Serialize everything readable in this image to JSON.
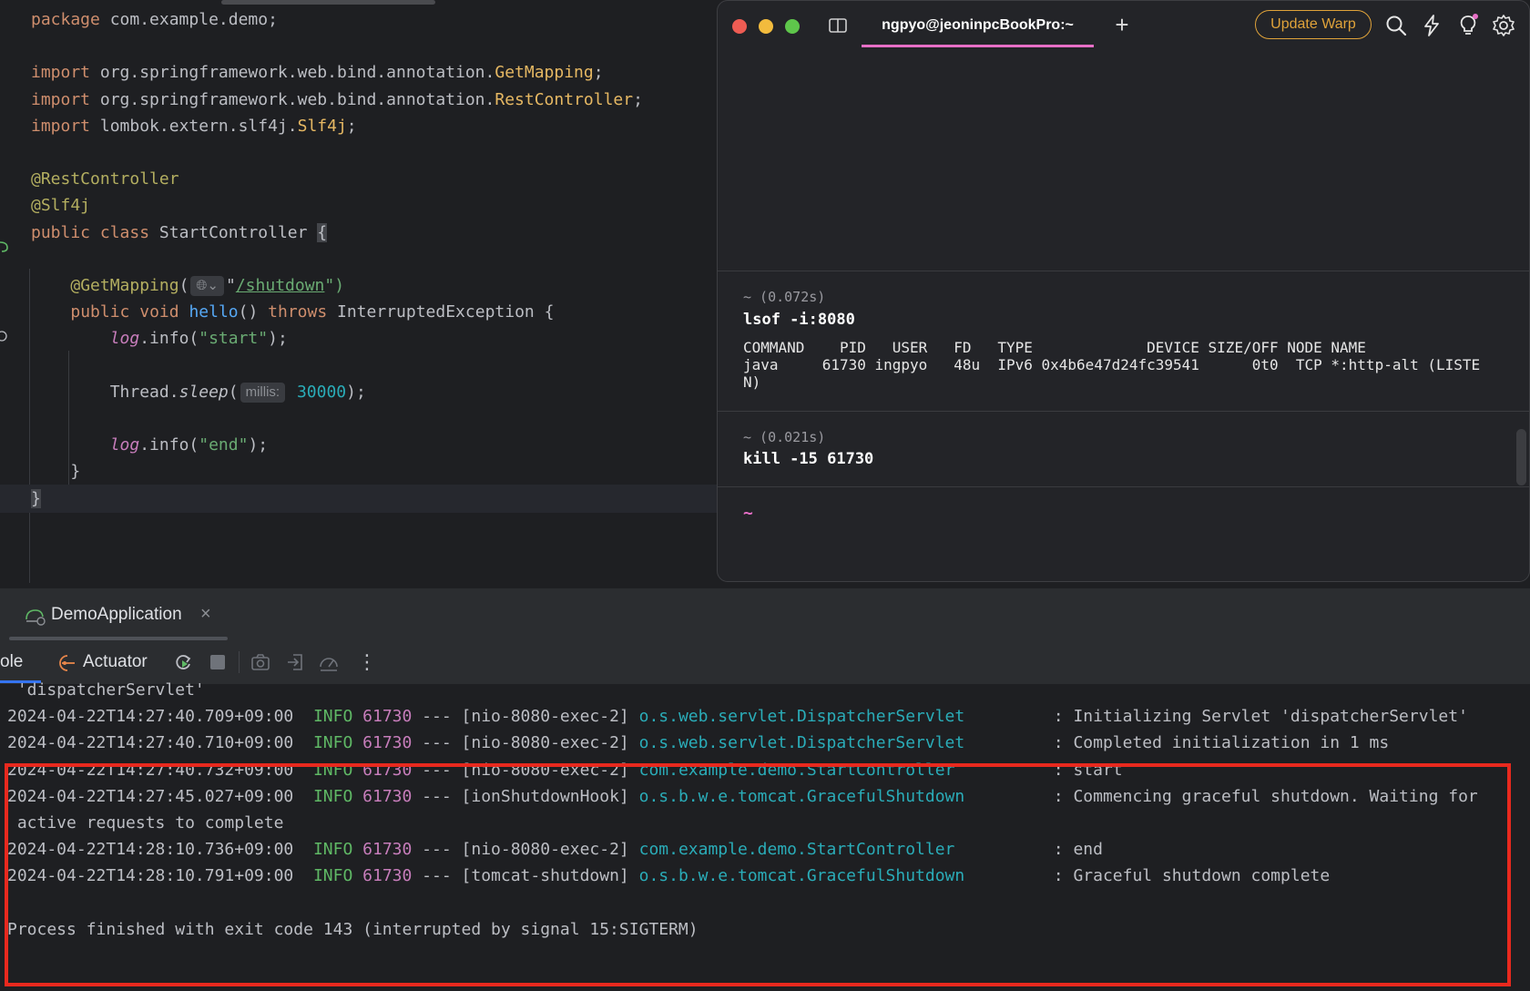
{
  "editor": {
    "lines": [
      {
        "tokens": [
          {
            "t": "package",
            "c": "kw"
          },
          {
            "t": " com.example.demo;"
          }
        ]
      },
      {
        "tokens": []
      },
      {
        "tokens": [
          {
            "t": "import",
            "c": "kw"
          },
          {
            "t": " org.springframework.web.bind.annotation."
          },
          {
            "t": "GetMapping",
            "c": "cls"
          },
          {
            "t": ";"
          }
        ]
      },
      {
        "tokens": [
          {
            "t": "import",
            "c": "kw"
          },
          {
            "t": " org.springframework.web.bind.annotation."
          },
          {
            "t": "RestController",
            "c": "cls"
          },
          {
            "t": ";"
          }
        ]
      },
      {
        "tokens": [
          {
            "t": "import",
            "c": "kw"
          },
          {
            "t": " lombok.extern.slf4j."
          },
          {
            "t": "Slf4j",
            "c": "cls"
          },
          {
            "t": ";"
          }
        ]
      },
      {
        "tokens": []
      },
      {
        "tokens": [
          {
            "t": "@RestController",
            "c": "ann"
          }
        ]
      },
      {
        "tokens": [
          {
            "t": "@Slf4j",
            "c": "ann"
          }
        ]
      },
      {
        "tokens": [
          {
            "t": "public",
            "c": "kw"
          },
          {
            "t": " "
          },
          {
            "t": "class",
            "c": "kw"
          },
          {
            "t": " StartController "
          },
          {
            "t": "{",
            "c": "brace-hl"
          }
        ]
      },
      {
        "tokens": []
      },
      {
        "tokens": [
          {
            "t": "    "
          },
          {
            "t": "@GetMapping",
            "c": "ann"
          },
          {
            "t": "("
          },
          {
            "t": "🌐︎⌄",
            "c": "hint-icon"
          },
          {
            "t": "\""
          },
          {
            "t": "/shutdown",
            "c": "link"
          },
          {
            "t": "\")",
            "c": "str"
          }
        ]
      },
      {
        "tokens": [
          {
            "t": "    "
          },
          {
            "t": "public",
            "c": "kw"
          },
          {
            "t": " "
          },
          {
            "t": "void",
            "c": "kw"
          },
          {
            "t": " "
          },
          {
            "t": "hello",
            "c": "fn"
          },
          {
            "t": "() "
          },
          {
            "t": "throws",
            "c": "kw"
          },
          {
            "t": " InterruptedException {"
          }
        ]
      },
      {
        "tokens": [
          {
            "t": "        "
          },
          {
            "t": "log",
            "c": "ital"
          },
          {
            "t": ".info("
          },
          {
            "t": "\"start\"",
            "c": "str"
          },
          {
            "t": ");"
          }
        ]
      },
      {
        "tokens": []
      },
      {
        "tokens": [
          {
            "t": "        Thread."
          },
          {
            "t": "sleep",
            "c": "slp"
          },
          {
            "t": "("
          },
          {
            "t": "millis:",
            "c": "hint"
          },
          {
            "t": " "
          },
          {
            "t": "30000",
            "c": "num"
          },
          {
            "t": ");"
          }
        ]
      },
      {
        "tokens": []
      },
      {
        "tokens": [
          {
            "t": "        "
          },
          {
            "t": "log",
            "c": "ital"
          },
          {
            "t": ".info("
          },
          {
            "t": "\"end\"",
            "c": "str"
          },
          {
            "t": ");"
          }
        ]
      },
      {
        "tokens": [
          {
            "t": "    }"
          }
        ]
      },
      {
        "tokens": [
          {
            "t": "}",
            "c": "brace-hl"
          }
        ]
      }
    ]
  },
  "terminal": {
    "tab_title": "ngpyo@jeoninpcBookPro:~",
    "update_button": "Update Warp",
    "blocks": [
      {
        "meta": "~ (0.072s)",
        "command": "lsof -i:8080",
        "output": "COMMAND    PID   USER   FD   TYPE             DEVICE SIZE/OFF NODE NAME\njava     61730 ingpyo   48u  IPv6 0x4b6e47d24fc39541      0t0  TCP *:http-alt (LISTE\nN)"
      },
      {
        "meta": "~ (0.021s)",
        "command": "kill -15 61730",
        "output": ""
      }
    ],
    "prompt": "~",
    "colors": {
      "accent": "#e86fc7",
      "update": "#e0a33a"
    }
  },
  "run": {
    "tab_label": "DemoApplication",
    "close_glyph": "×",
    "console_tab": "ole",
    "actuator_tab": "Actuator",
    "toolbar_icons": [
      "rerun-icon",
      "stop-icon",
      "screenshot-icon",
      "exit-icon",
      "dashboard-icon",
      "more-icon"
    ],
    "more_glyph": "⋮"
  },
  "console": {
    "lines": [
      {
        "text": " 'dispatcherServlet'"
      },
      {
        "ts": "2024-04-22T14:27:40.709+09:00",
        "lvl": "INFO",
        "pid": "61730",
        "sep": " --- ",
        "thr": "[nio-8080-exec-2]",
        "logger": "o.s.web.servlet.DispatcherServlet",
        "msg": ": Initializing Servlet 'dispatcherServlet'"
      },
      {
        "ts": "2024-04-22T14:27:40.710+09:00",
        "lvl": "INFO",
        "pid": "61730",
        "sep": " --- ",
        "thr": "[nio-8080-exec-2]",
        "logger": "o.s.web.servlet.DispatcherServlet",
        "msg": ": Completed initialization in 1 ms"
      },
      {
        "ts": "2024-04-22T14:27:40.732+09:00",
        "lvl": "INFO",
        "pid": "61730",
        "sep": " --- ",
        "thr": "[nio-8080-exec-2]",
        "logger": "com.example.demo.StartController",
        "msg": ": start"
      },
      {
        "ts": "2024-04-22T14:27:45.027+09:00",
        "lvl": "INFO",
        "pid": "61730",
        "sep": " --- ",
        "thr": "[ionShutdownHook]",
        "logger": "o.s.b.w.e.tomcat.GracefulShutdown",
        "msg": ": Commencing graceful shutdown. Waiting for"
      },
      {
        "text": " active requests to complete"
      },
      {
        "ts": "2024-04-22T14:28:10.736+09:00",
        "lvl": "INFO",
        "pid": "61730",
        "sep": " --- ",
        "thr": "[nio-8080-exec-2]",
        "logger": "com.example.demo.StartController",
        "msg": ": end"
      },
      {
        "ts": "2024-04-22T14:28:10.791+09:00",
        "lvl": "INFO",
        "pid": "61730",
        "sep": " --- ",
        "thr": "[tomcat-shutdown]",
        "logger": "o.s.b.w.e.tomcat.GracefulShutdown",
        "msg": ": Graceful shutdown complete"
      },
      {
        "text": ""
      },
      {
        "text": "Process finished with exit code 143 (interrupted by signal 15:SIGTERM)"
      }
    ],
    "colors": {
      "level": "#5fb865",
      "pid": "#c77dbb",
      "logger": "#2aacb8",
      "highlight": "#e8291e"
    }
  }
}
